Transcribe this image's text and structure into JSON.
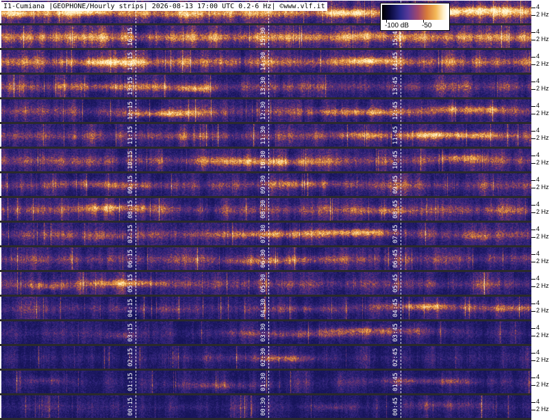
{
  "header": {
    "title": "I1-Cumiana |GEOPHONE/Hourly strips| 2026-08-13 17:00 UTC 0.2-6 Hz| ©www.vlf.it"
  },
  "colorbar": {
    "min_label": "-100 dB",
    "max_label": "-50",
    "colors": [
      "#000000",
      "#2a2a8a",
      "#a4486a",
      "#f4b858",
      "#ffffff"
    ]
  },
  "y_axis": {
    "label_high": "4",
    "label_low": "2 Hz"
  },
  "strips": [
    {
      "hour": 17,
      "time_labels": [
        "",
        "",
        ""
      ],
      "intensity": 0.95
    },
    {
      "hour": 16,
      "time_labels": [
        "16:15",
        "15:30",
        "15:45"
      ],
      "intensity": 0.88
    },
    {
      "hour": 15,
      "time_labels": [
        "14:15",
        "14:30",
        "14:45"
      ],
      "intensity": 0.82
    },
    {
      "hour": 14,
      "time_labels": [
        "13:15",
        "13:30",
        "13:45"
      ],
      "intensity": 0.6
    },
    {
      "hour": 13,
      "time_labels": [
        "12:15",
        "12:30",
        "12:45"
      ],
      "intensity": 0.58
    },
    {
      "hour": 12,
      "time_labels": [
        "11:15",
        "11:30",
        "11:45"
      ],
      "intensity": 0.62
    },
    {
      "hour": 11,
      "time_labels": [
        "10:15",
        "10:30",
        "10:45"
      ],
      "intensity": 0.65
    },
    {
      "hour": 10,
      "time_labels": [
        "09:15",
        "09:30",
        "09:45"
      ],
      "intensity": 0.6
    },
    {
      "hour": 9,
      "time_labels": [
        "08:15",
        "08:30",
        "08:45"
      ],
      "intensity": 0.63
    },
    {
      "hour": 8,
      "time_labels": [
        "07:15",
        "07:30",
        "07:45"
      ],
      "intensity": 0.62
    },
    {
      "hour": 7,
      "time_labels": [
        "06:15",
        "06:30",
        "06:45"
      ],
      "intensity": 0.58
    },
    {
      "hour": 6,
      "time_labels": [
        "05:15",
        "05:30",
        "05:45"
      ],
      "intensity": 0.55
    },
    {
      "hour": 5,
      "time_labels": [
        "04:15",
        "04:30",
        "04:45"
      ],
      "intensity": 0.42
    },
    {
      "hour": 4,
      "time_labels": [
        "03:15",
        "03:30",
        "03:45"
      ],
      "intensity": 0.32
    },
    {
      "hour": 3,
      "time_labels": [
        "02:15",
        "02:30",
        "02:45"
      ],
      "intensity": 0.28
    },
    {
      "hour": 2,
      "time_labels": [
        "01:15",
        "01:30",
        "01:45"
      ],
      "intensity": 0.26
    },
    {
      "hour": 1,
      "time_labels": [
        "00:15",
        "00:30",
        "00:45"
      ],
      "intensity": 0.27
    }
  ]
}
